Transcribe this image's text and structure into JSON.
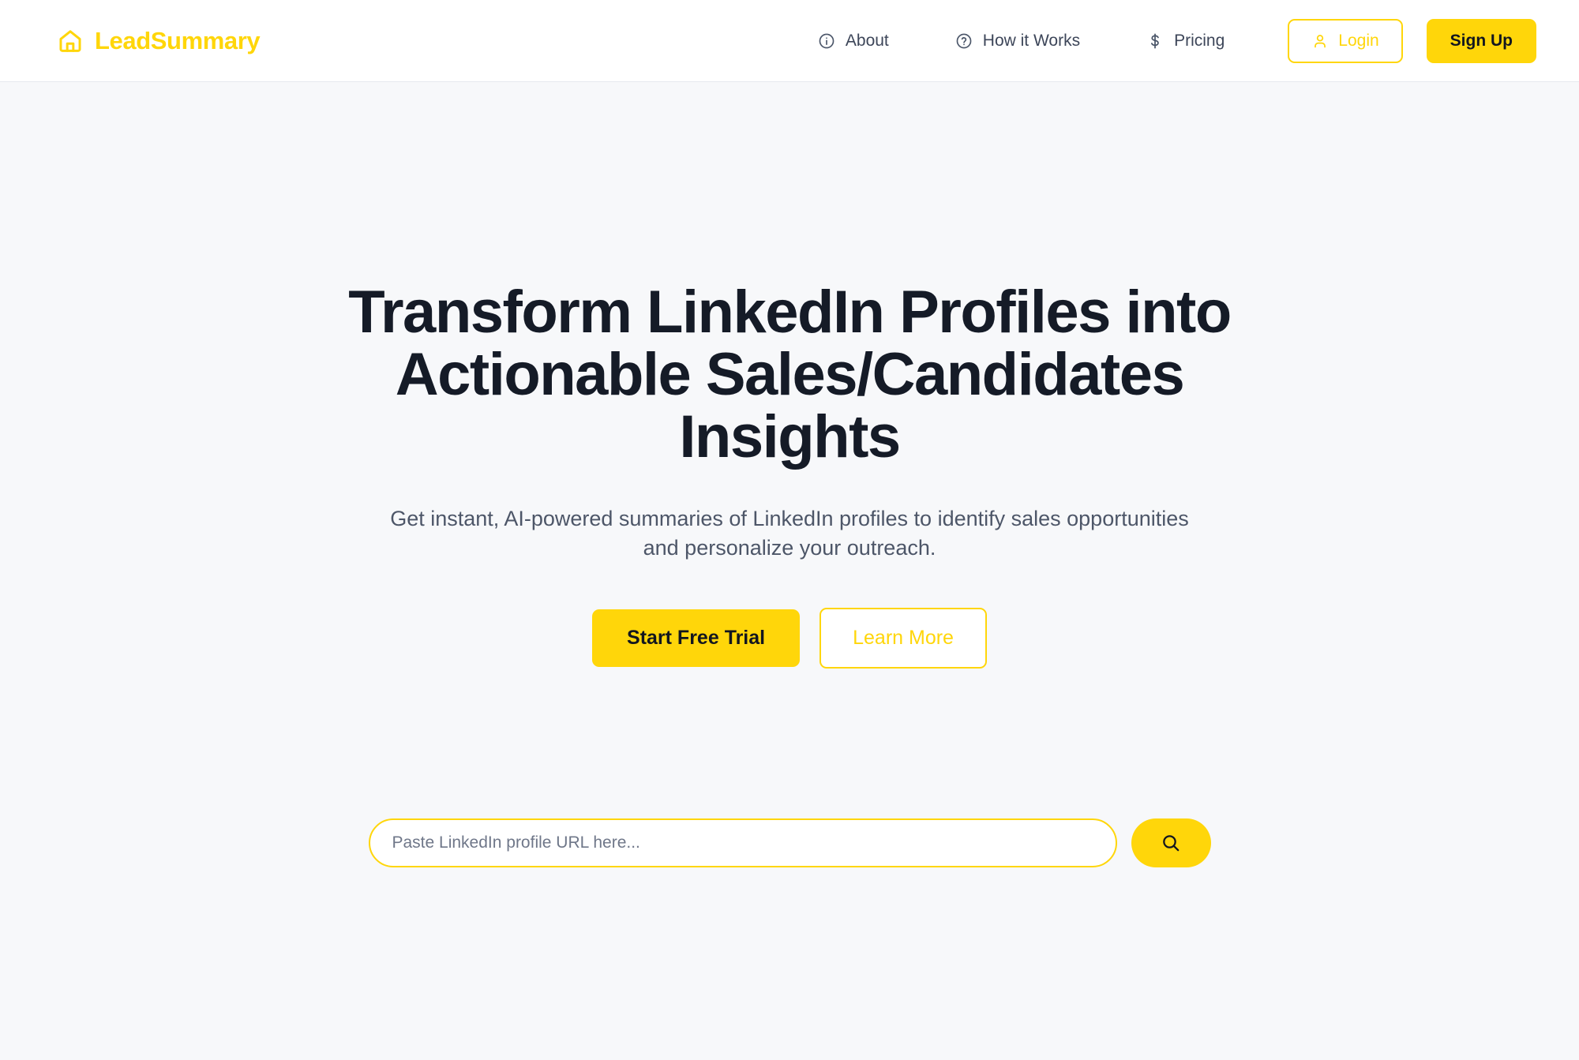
{
  "header": {
    "brand": {
      "icon": "home-icon",
      "name": "LeadSummary"
    },
    "nav": [
      {
        "icon": "info-circle-icon",
        "label": "About"
      },
      {
        "icon": "question-circle-icon",
        "label": "How it Works"
      },
      {
        "icon": "dollar-icon",
        "label": "Pricing"
      }
    ],
    "auth": {
      "login_label": "Login",
      "login_icon": "user-icon",
      "signup_label": "Sign Up"
    }
  },
  "hero": {
    "title": "Transform LinkedIn Profiles into Actionable Sales/Candidates Insights",
    "subtitle": "Get instant, AI-powered summaries of LinkedIn profiles to identify sales opportunities and personalize your outreach.",
    "primary_cta": "Start Free Trial",
    "secondary_cta": "Learn More"
  },
  "search": {
    "placeholder": "Paste LinkedIn profile URL here...",
    "value": "",
    "button_icon": "search-icon"
  },
  "colors": {
    "accent": "#ffd60a",
    "page_bg": "#f7f8fa",
    "header_bg": "#ffffff",
    "heading_text": "#151b27",
    "body_text": "#4d5668"
  }
}
